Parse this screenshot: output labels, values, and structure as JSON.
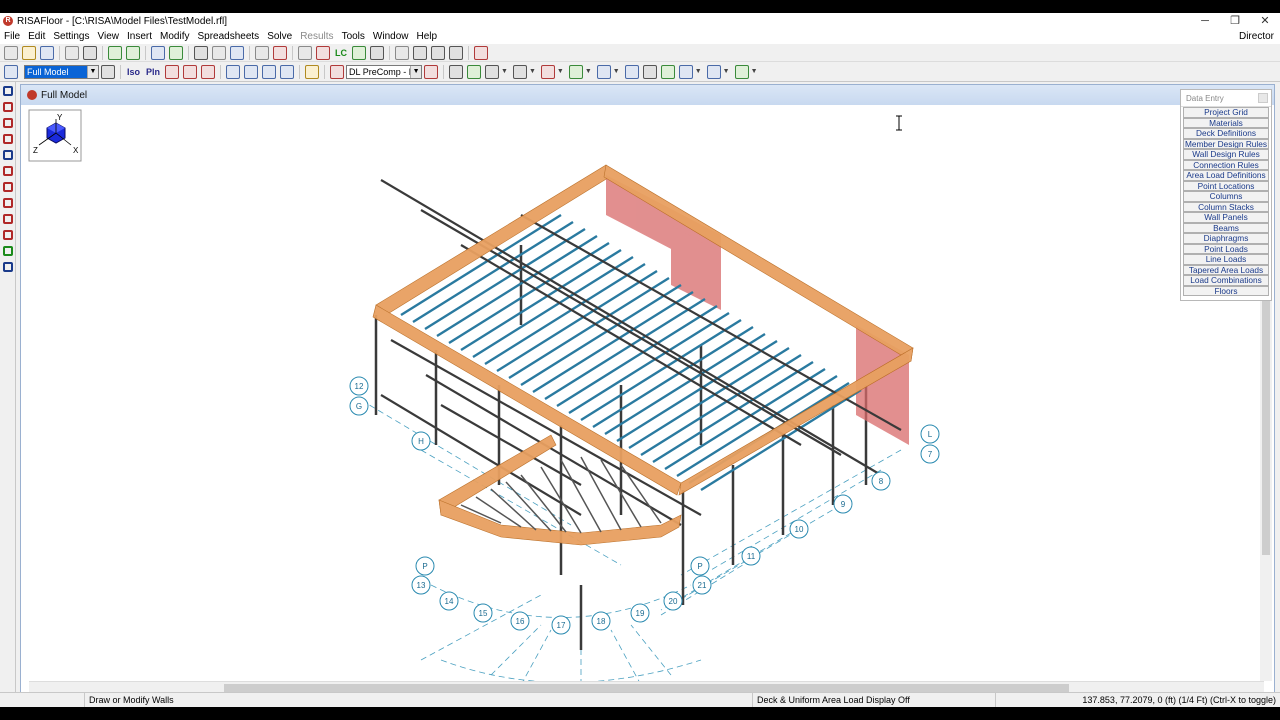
{
  "window": {
    "title": "RISAFloor - [C:\\RISA\\Model Files\\TestModel.rfl]",
    "minimize": "─",
    "maximize": "❐",
    "close": "✕"
  },
  "menu": {
    "items": [
      "File",
      "Edit",
      "Settings",
      "View",
      "Insert",
      "Modify",
      "Spreadsheets",
      "Solve",
      "Results",
      "Tools",
      "Window",
      "Help"
    ],
    "disabled": [
      "Results"
    ],
    "right_label": "Director"
  },
  "toolbar2": {
    "view_combo": "Full Model",
    "iso_label": "Iso",
    "pln_label": "Pln",
    "lc_combo": "DL PreComp - Pr",
    "lc_label": "LC"
  },
  "child_window": {
    "title": "Full Model"
  },
  "axes": {
    "y": "Y",
    "x": "X",
    "z": "Z"
  },
  "grid_labels": {
    "left_column": [
      "12",
      "G",
      "H",
      "P",
      "13",
      "14",
      "15",
      "16",
      "17",
      "18",
      "19",
      "20",
      "21",
      "P"
    ],
    "right_column": [
      "L",
      "7",
      "8",
      "9",
      "10",
      "11"
    ]
  },
  "data_entry": {
    "title": "Data Entry",
    "items": [
      "Project Grid",
      "Materials",
      "Deck Definitions",
      "Member Design Rules",
      "Wall Design Rules",
      "Connection Rules",
      "Area Load Definitions",
      "Point Locations",
      "Columns",
      "Column Stacks",
      "Wall Panels",
      "Beams",
      "Diaphragms",
      "Point Loads",
      "Line Loads",
      "Tapered Area Loads",
      "Load Combinations",
      "Floors"
    ]
  },
  "status": {
    "left": "",
    "hint": "Draw or Modify Walls",
    "display": "Deck & Uniform Area Load Display Off",
    "coords": "137.853, 77.2079, 0 (ft) (1/4 Ft)   (Ctrl-X to toggle)"
  },
  "colors": {
    "beam_dark": "#3a3a3a",
    "deck_blue": "#2a7aa0",
    "wall_orange": "#e8a060",
    "wall_red": "#d86a6a",
    "grid_cyan": "#4aa0c0"
  }
}
